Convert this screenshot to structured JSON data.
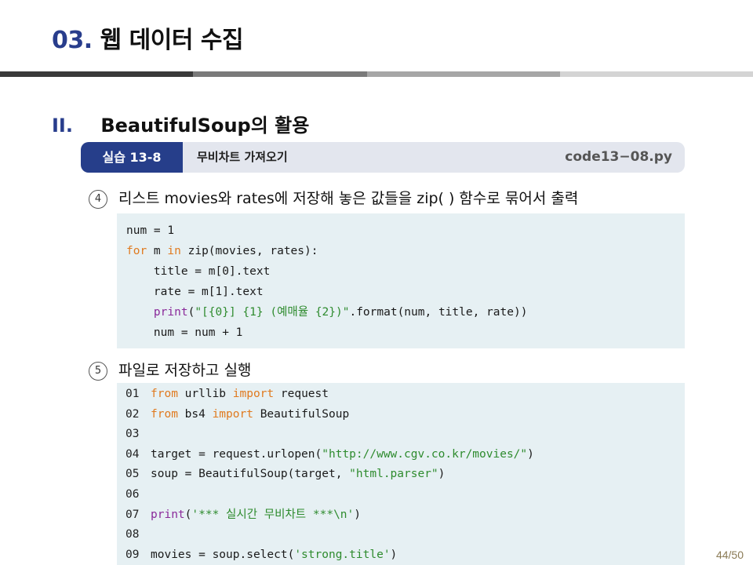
{
  "header": {
    "number": "03.",
    "title": "웹 데이터 수집"
  },
  "section": {
    "roman": "II.",
    "title": "BeautifulSoup의 활용"
  },
  "practice": {
    "tag": "실습 13-8",
    "title": "무비차트 가져오기",
    "filename": "code13−08.py"
  },
  "steps": [
    {
      "marker": "4",
      "text": "리스트 movies와 rates에 저장해 놓은 값들을 zip( ) 함수로 묶어서 출력"
    },
    {
      "marker": "5",
      "text": "파일로 저장하고 실행"
    }
  ],
  "code1": [
    {
      "parts": [
        {
          "t": "num = 1",
          "c": ""
        }
      ]
    },
    {
      "parts": [
        {
          "t": "for",
          "c": "kw"
        },
        {
          "t": " m ",
          "c": ""
        },
        {
          "t": "in",
          "c": "kw"
        },
        {
          "t": " zip(movies, rates):",
          "c": ""
        }
      ]
    },
    {
      "parts": [
        {
          "t": "    title = m[0].text",
          "c": ""
        }
      ]
    },
    {
      "parts": [
        {
          "t": "    rate = m[1].text",
          "c": ""
        }
      ]
    },
    {
      "parts": [
        {
          "t": "    print",
          "c": "fn"
        },
        {
          "t": "(",
          "c": ""
        },
        {
          "t": "\"[{0}] {1} (예매율 {2})\"",
          "c": "str"
        },
        {
          "t": ".format(num, title, rate))",
          "c": ""
        }
      ]
    },
    {
      "parts": [
        {
          "t": "    num = num + 1",
          "c": ""
        }
      ]
    }
  ],
  "code2": [
    {
      "n": "01",
      "parts": [
        {
          "t": "from",
          "c": "kw"
        },
        {
          "t": " urllib ",
          "c": ""
        },
        {
          "t": "import",
          "c": "kw"
        },
        {
          "t": " request",
          "c": ""
        }
      ]
    },
    {
      "n": "02",
      "parts": [
        {
          "t": "from",
          "c": "kw"
        },
        {
          "t": " bs4 ",
          "c": ""
        },
        {
          "t": "import",
          "c": "kw"
        },
        {
          "t": " BeautifulSoup",
          "c": ""
        }
      ]
    },
    {
      "n": "03",
      "parts": []
    },
    {
      "n": "04",
      "parts": [
        {
          "t": "target = request.urlopen(",
          "c": ""
        },
        {
          "t": "\"http://www.cgv.co.kr/movies/\"",
          "c": "str"
        },
        {
          "t": ")",
          "c": ""
        }
      ]
    },
    {
      "n": "05",
      "parts": [
        {
          "t": "soup = BeautifulSoup(target, ",
          "c": ""
        },
        {
          "t": "\"html.parser\"",
          "c": "str"
        },
        {
          "t": ")",
          "c": ""
        }
      ]
    },
    {
      "n": "06",
      "parts": []
    },
    {
      "n": "07",
      "parts": [
        {
          "t": "print",
          "c": "fn"
        },
        {
          "t": "(",
          "c": ""
        },
        {
          "t": "'*** 실시간 무비차트 ***\\n'",
          "c": "str"
        },
        {
          "t": ")",
          "c": ""
        }
      ]
    },
    {
      "n": "08",
      "parts": []
    },
    {
      "n": "09",
      "parts": [
        {
          "t": "movies = soup.select(",
          "c": ""
        },
        {
          "t": "'strong.title'",
          "c": "str"
        },
        {
          "t": ")",
          "c": ""
        }
      ]
    }
  ],
  "footer": {
    "page": "44/50"
  }
}
